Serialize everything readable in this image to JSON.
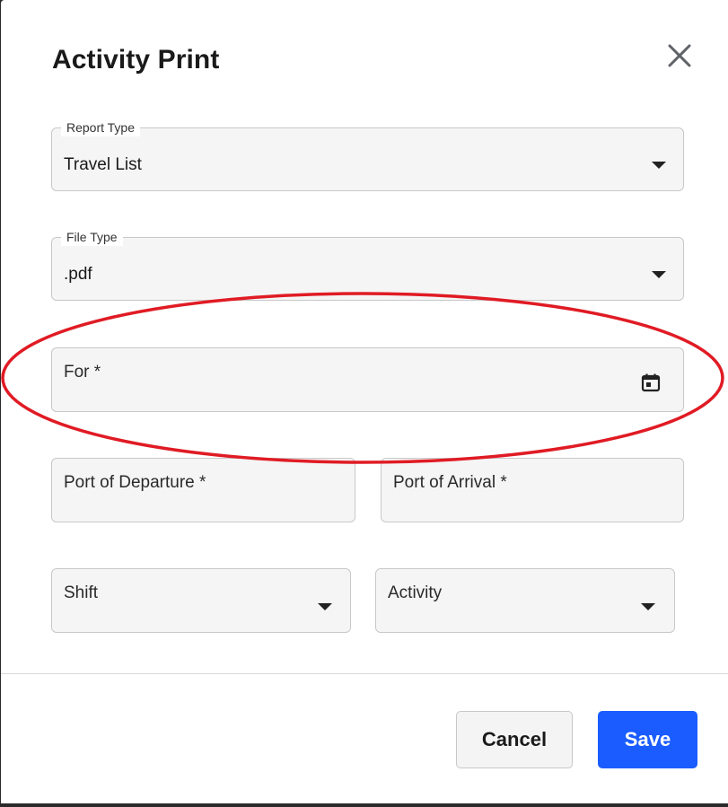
{
  "dialog": {
    "title": "Activity Print",
    "close_icon": "close-icon"
  },
  "fields": {
    "report_type": {
      "legend": "Report Type",
      "value": "Travel List"
    },
    "file_type": {
      "legend": "File Type",
      "value": ".pdf"
    },
    "for_date": {
      "label": "For *",
      "icon": "calendar-icon"
    },
    "port_of_departure": {
      "label": "Port of Departure *"
    },
    "port_of_arrival": {
      "label": "Port of Arrival *"
    },
    "shift": {
      "label": "Shift"
    },
    "activity": {
      "label": "Activity"
    }
  },
  "actions": {
    "cancel_label": "Cancel",
    "save_label": "Save"
  },
  "annotation": {
    "color": "#e01b24"
  },
  "colors": {
    "primary": "#1a5cff",
    "field_bg": "#f5f5f5",
    "border": "#c8c8c8"
  }
}
